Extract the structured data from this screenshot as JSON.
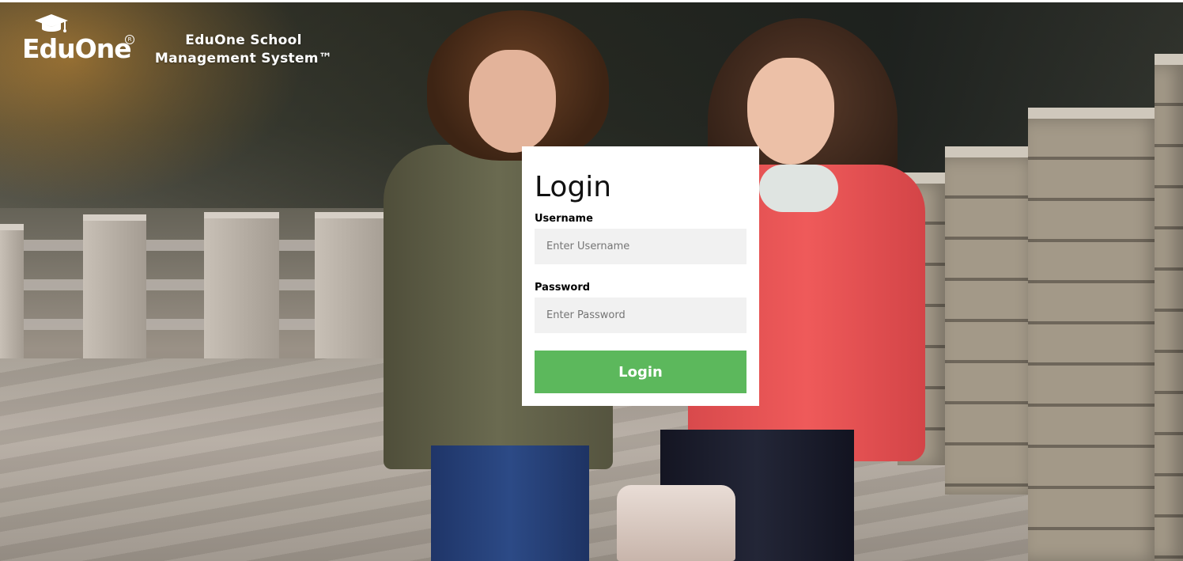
{
  "header": {
    "logo_text": "EduOne",
    "logo_registered": "R",
    "title_line1": "EduOne School",
    "title_line2": "Management System™"
  },
  "login": {
    "heading": "Login",
    "username": {
      "label": "Username",
      "placeholder": "Enter Username",
      "value": ""
    },
    "password": {
      "label": "Password",
      "placeholder": "Enter Password",
      "value": ""
    },
    "submit_label": "Login"
  },
  "colors": {
    "submit_button": "#5cb85c",
    "card_background": "#ffffff",
    "input_background": "#f1f1f1"
  },
  "icons": {
    "logo_cap": "graduation-cap-icon"
  }
}
